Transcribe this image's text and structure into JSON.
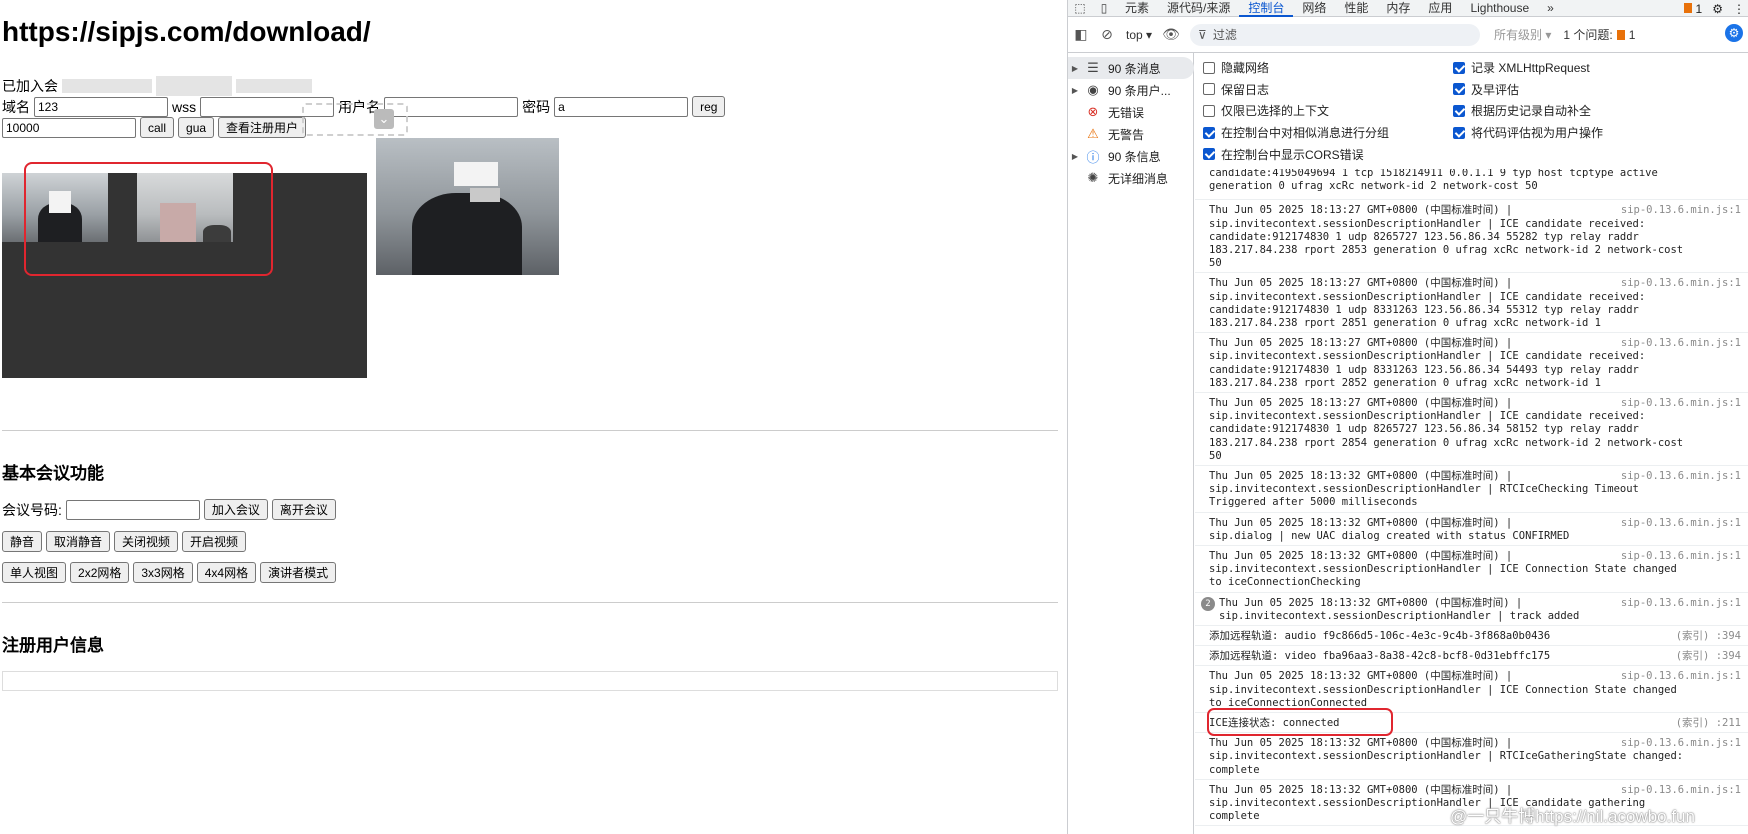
{
  "page": {
    "url_title": "https://sipjs.com/download/",
    "joined_label": "已加入会",
    "domain_label": "域名",
    "domain_value": "123",
    "wss_label": "wss",
    "username_label": "用户名",
    "password_label": "密码",
    "password_value": "a",
    "reg_label": "reg",
    "number_value": "10000",
    "call_label": "call",
    "gua_label": "gua",
    "view_users_label": "查看注册用户"
  },
  "meeting": {
    "title": "基本会议功能",
    "number_label": "会议号码:",
    "join_label": "加入会议",
    "leave_label": "离开会议",
    "mute_label": "静音",
    "unmute_label": "取消静音",
    "video_off_label": "关闭视频",
    "video_on_label": "开启视频",
    "single_view_label": "单人视图",
    "grid2_label": "2x2网格",
    "grid3_label": "3x3网格",
    "grid4_label": "4x4网格",
    "speaker_mode_label": "演讲者模式"
  },
  "userinfo": {
    "title": "注册用户信息"
  },
  "devtools": {
    "tabs": [
      "元素",
      "源代码/来源",
      "控制台",
      "网络",
      "性能",
      "内存",
      "应用",
      "Lighthouse"
    ],
    "active_tab": "控制台",
    "more_tabs": "»",
    "warn_count": "1",
    "context": "top ▾",
    "filter_placeholder": "过滤",
    "levels": "所有级别 ▾",
    "issues_label": "1 个问题:",
    "issues_count": "1",
    "sidebar": [
      {
        "label": "90 条消息",
        "icon": "☰",
        "expand": true
      },
      {
        "label": "90 条用户...",
        "icon": "◉",
        "expand": true
      },
      {
        "label": "无错误",
        "icon": "⊗",
        "expand": false
      },
      {
        "label": "无警告",
        "icon": "⚠",
        "expand": false
      },
      {
        "label": "90 条信息",
        "icon": "ⓘ",
        "expand": true
      },
      {
        "label": "无详细消息",
        "icon": "✺",
        "expand": false
      }
    ],
    "settings": [
      {
        "label": "隐藏网络",
        "checked": false
      },
      {
        "label": "记录 XMLHttpRequest",
        "checked": true
      },
      {
        "label": "保留日志",
        "checked": false
      },
      {
        "label": "及早评估",
        "checked": true
      },
      {
        "label": "仅限已选择的上下文",
        "checked": false
      },
      {
        "label": "根据历史记录自动补全",
        "checked": true
      },
      {
        "label": "在控制台中对相似消息进行分组",
        "checked": true
      },
      {
        "label": "将代码评估视为用户操作",
        "checked": true
      },
      {
        "label": "在控制台中显示CORS错误",
        "checked": true
      }
    ],
    "messages": [
      {
        "text": "candidate:4195049694 1 tcp 1518214911 0.0.1.1 9 typ host tcptype active\ngeneration 0 ufrag xcRc network-id 2 network-cost 50",
        "src": ""
      },
      {
        "text": "Thu Jun 05 2025 18:13:27 GMT+0800 (中国标准时间) |\nsip.invitecontext.sessionDescriptionHandler | ICE candidate received:\ncandidate:912174830 1 udp 8265727 123.56.86.34 55282 typ relay raddr\n183.217.84.238 rport 2853 generation 0 ufrag xcRc network-id 2 network-cost\n50",
        "src": "sip-0.13.6.min.js:1"
      },
      {
        "text": "Thu Jun 05 2025 18:13:27 GMT+0800 (中国标准时间) |\nsip.invitecontext.sessionDescriptionHandler | ICE candidate received:\ncandidate:912174830 1 udp 8331263 123.56.86.34 55312 typ relay raddr\n183.217.84.238 rport 2851 generation 0 ufrag xcRc network-id 1",
        "src": "sip-0.13.6.min.js:1"
      },
      {
        "text": "Thu Jun 05 2025 18:13:27 GMT+0800 (中国标准时间) |\nsip.invitecontext.sessionDescriptionHandler | ICE candidate received:\ncandidate:912174830 1 udp 8331263 123.56.86.34 54493 typ relay raddr\n183.217.84.238 rport 2852 generation 0 ufrag xcRc network-id 1",
        "src": "sip-0.13.6.min.js:1"
      },
      {
        "text": "Thu Jun 05 2025 18:13:27 GMT+0800 (中国标准时间) |\nsip.invitecontext.sessionDescriptionHandler | ICE candidate received:\ncandidate:912174830 1 udp 8265727 123.56.86.34 58152 typ relay raddr\n183.217.84.238 rport 2854 generation 0 ufrag xcRc network-id 2 network-cost\n50",
        "src": "sip-0.13.6.min.js:1"
      },
      {
        "text": "Thu Jun 05 2025 18:13:32 GMT+0800 (中国标准时间) |\nsip.invitecontext.sessionDescriptionHandler | RTCIceChecking Timeout\nTriggered after 5000 milliseconds",
        "src": "sip-0.13.6.min.js:1"
      },
      {
        "text": "Thu Jun 05 2025 18:13:32 GMT+0800 (中国标准时间) |\nsip.dialog | new UAC dialog created with status CONFIRMED",
        "src": "sip-0.13.6.min.js:1"
      },
      {
        "text": "Thu Jun 05 2025 18:13:32 GMT+0800 (中国标准时间) |\nsip.invitecontext.sessionDescriptionHandler | ICE Connection State changed\nto iceConnectionChecking",
        "src": "sip-0.13.6.min.js:1"
      },
      {
        "text": "Thu Jun 05 2025 18:13:32 GMT+0800 (中国标准时间) |\nsip.invitecontext.sessionDescriptionHandler | track added",
        "src": "sip-0.13.6.min.js:1",
        "count": "2"
      },
      {
        "text": "添加远程轨道: audio f9c866d5-106c-4e3c-9c4b-3f868a0b0436",
        "src": "(索引) :394"
      },
      {
        "text": "添加远程轨道: video fba96aa3-8a38-42c8-bcf8-0d31ebffc175",
        "src": "(索引) :394"
      },
      {
        "text": "Thu Jun 05 2025 18:13:32 GMT+0800 (中国标准时间) |\nsip.invitecontext.sessionDescriptionHandler | ICE Connection State changed\nto iceConnectionConnected",
        "src": "sip-0.13.6.min.js:1"
      },
      {
        "text": "ICE连接状态: connected",
        "src": "(索引) :211"
      },
      {
        "text": "Thu Jun 05 2025 18:13:32 GMT+0800 (中国标准时间) |\nsip.invitecontext.sessionDescriptionHandler | RTCIceGatheringState changed:\ncomplete",
        "src": "sip-0.13.6.min.js:1"
      },
      {
        "text": "Thu Jun 05 2025 18:13:32 GMT+0800 (中国标准时间) |\nsip.invitecontext.sessionDescriptionHandler | ICE candidate gathering\ncomplete",
        "src": "sip-0.13.6.min.js:1"
      }
    ]
  },
  "watermark": "@一只牛博https://nil.acowbo.fun"
}
